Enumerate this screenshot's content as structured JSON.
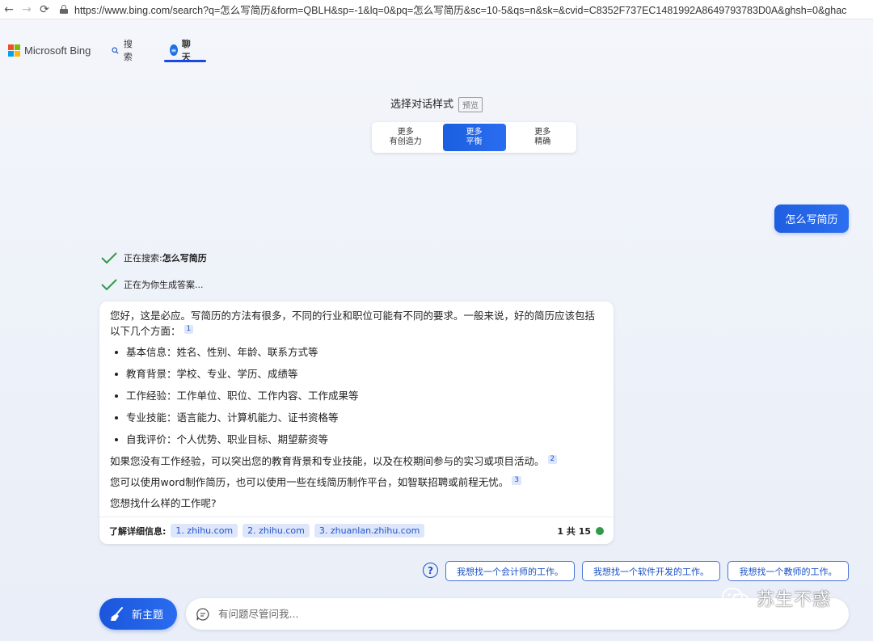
{
  "browser": {
    "url": "https://www.bing.com/search?q=怎么写简历&form=QBLH&sp=-1&lq=0&pq=怎么写简历&sc=10-5&qs=n&sk=&cvid=C8352F737EC1481992A8649793783D0A&ghsh=0&ghac"
  },
  "header": {
    "brand": "Microsoft Bing",
    "nav_search": "搜索",
    "nav_chat": "聊天"
  },
  "style_selector": {
    "title": "选择对话样式",
    "badge": "预览",
    "options": [
      {
        "line1": "更多",
        "line2": "有创造力"
      },
      {
        "line1": "更多",
        "line2": "平衡"
      },
      {
        "line1": "更多",
        "line2": "精确"
      }
    ]
  },
  "user_message": "怎么写简历",
  "status": {
    "searching_prefix": "正在搜索: ",
    "searching_query": "怎么写简历",
    "generating": "正在为你生成答案..."
  },
  "answer": {
    "intro": "您好，这是必应。写简历的方法有很多，不同的行业和职位可能有不同的要求。一般来说，好的简历应该包括以下几个方面：",
    "intro_cite": "1",
    "bullets": [
      "基本信息：姓名、性别、年龄、联系方式等",
      "教育背景：学校、专业、学历、成绩等",
      "工作经验：工作单位、职位、工作内容、工作成果等",
      "专业技能：语言能力、计算机能力、证书资格等",
      "自我评价：个人优势、职业目标、期望薪资等"
    ],
    "para2": "如果您没有工作经验，可以突出您的教育背景和专业技能，以及在校期间参与的实习或项目活动。",
    "para2_cite": "2",
    "para3": "您可以使用word制作简历，也可以使用一些在线简历制作平台，如智联招聘或前程无忧。",
    "para3_cite": "3",
    "question": "您想找什么样的工作呢?",
    "learn_more": "了解详细信息:",
    "sources": [
      "1. zhihu.com",
      "2. zhihu.com",
      "3. zhuanlan.zhihu.com"
    ],
    "count": "1 共 15"
  },
  "suggestions": [
    "我想找一个会计师的工作。",
    "我想找一个软件开发的工作。",
    "我想找一个教师的工作。"
  ],
  "composer": {
    "new_topic": "新主题",
    "placeholder": "有问题尽管问我..."
  },
  "watermark": "苏生不惑",
  "colors": {
    "accent": "#1a5fe0",
    "success": "#2e9a4a"
  }
}
